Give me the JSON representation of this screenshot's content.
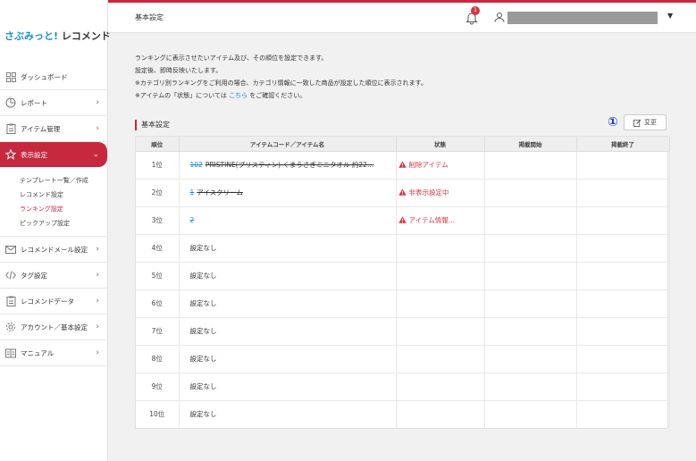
{
  "app": {
    "logo_part1": "さぶみっと!",
    "logo_part2": " レコメンド"
  },
  "header": {
    "title": "基本設定",
    "notification_count": "1",
    "user_name": ""
  },
  "sidebar": {
    "items": [
      {
        "label": "ダッシュボード",
        "icon": "dashboard-icon"
      },
      {
        "label": "レポート",
        "icon": "pie-chart-icon"
      },
      {
        "label": "アイテム管理",
        "icon": "clipboard-icon"
      },
      {
        "label": "表示設定",
        "icon": "star-icon"
      },
      {
        "label": "レコメンドメール設定",
        "icon": "mail-icon"
      },
      {
        "label": "タグ設定",
        "icon": "code-icon"
      },
      {
        "label": "レコメンドデータ",
        "icon": "document-icon"
      },
      {
        "label": "アカウント／基本設定",
        "icon": "gear-icon"
      },
      {
        "label": "マニュアル",
        "icon": "book-icon"
      }
    ],
    "sub_items": [
      "テンプレート一覧／作成",
      "レコメンド設定",
      "ランキング設定",
      "ピックアップ設定"
    ]
  },
  "description": {
    "line1": "ランキングに表示させたいアイテム及び、その順位を設定できます。",
    "line2": "設定後、即時反映いたします。",
    "line3": "※カテゴリ別ランキングをご利用の場合、カテゴリ情報に一致した商品が設定した順位に表示されます。",
    "line4_pre": "※アイテムの「状態」については",
    "line4_link": "こちら",
    "line4_post": "をご確認ください。"
  },
  "section": {
    "title": "基本設定",
    "marker": "①",
    "change_label": "変更"
  },
  "table": {
    "headers": [
      "順位",
      "アイテムコード／アイテム名",
      "状態",
      "掲載開始",
      "掲載終了"
    ],
    "rows": [
      {
        "rank": "1位",
        "code": "102",
        "name": "PRISTINE(プリスティン) くまうさぎミニタオル 約22…",
        "status": "削除アイテム"
      },
      {
        "rank": "2位",
        "code": "1",
        "name": "アイスクリーム",
        "status": "非表示設定中"
      },
      {
        "rank": "3位",
        "code": "2",
        "name": "",
        "status": "アイテム情報…"
      },
      {
        "rank": "4位",
        "plain": "設定なし"
      },
      {
        "rank": "5位",
        "plain": "設定なし"
      },
      {
        "rank": "6位",
        "plain": "設定なし"
      },
      {
        "rank": "7位",
        "plain": "設定なし"
      },
      {
        "rank": "8位",
        "plain": "設定なし"
      },
      {
        "rank": "9位",
        "plain": "設定なし"
      },
      {
        "rank": "10位",
        "plain": "設定なし"
      }
    ]
  },
  "colors": {
    "accent": "#c8283e",
    "link": "#1a8fd0",
    "warning": "#d93445"
  }
}
